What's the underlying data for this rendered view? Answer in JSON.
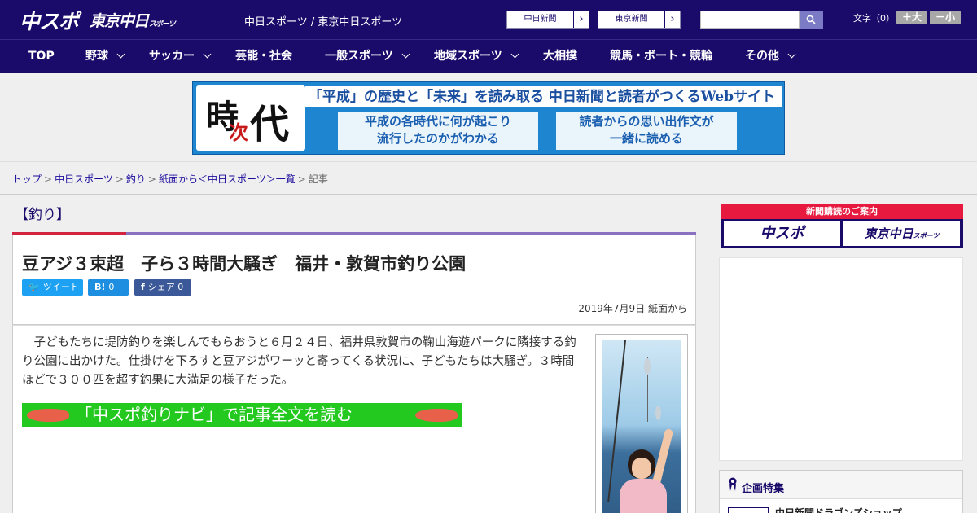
{
  "header": {
    "logo_chuspo": "中スポ",
    "logo_tokyo": "東京中日",
    "logo_tokyo_small": "スポーツ",
    "site_names": "中日スポーツ / 東京中日スポーツ",
    "paper_links": [
      "中日新聞",
      "東京新聞"
    ],
    "search_placeholder": "",
    "font_size_label": "文字（0）",
    "font_plus": "＋大",
    "font_minus": "－小"
  },
  "nav": {
    "items": [
      {
        "label": "TOP"
      },
      {
        "label": "野球"
      },
      {
        "label": "サッカー"
      },
      {
        "label": "芸能・社会"
      },
      {
        "label": "一般スポーツ"
      },
      {
        "label": "地域スポーツ"
      },
      {
        "label": "大相撲"
      },
      {
        "label": "競馬・ボート・競輪"
      },
      {
        "label": "その他"
      }
    ]
  },
  "banner": {
    "logo_char_1": "時",
    "logo_char_2": "次",
    "logo_char_3": "代",
    "title": "「平成」の歴史と「未来」を読み取る 中日新聞と読者がつくるWebサイト",
    "box1_line1": "平成の各時代に何が起こり",
    "box1_line2": "流行したのかがわかる",
    "box2_line1": "読者からの思い出作文が",
    "box2_line2": "一緒に読める"
  },
  "breadcrumb": {
    "items": [
      "トップ",
      "中日スポーツ",
      "釣り",
      "紙面から＜中日スポーツ＞一覧"
    ],
    "current": "記事",
    "separator": ">"
  },
  "category": {
    "label": "【釣り】"
  },
  "article": {
    "title": "豆アジ３束超　子ら３時間大騒ぎ　福井・敦賀市釣り公園",
    "share_tweet": "ツイート",
    "share_hatena_icon": "B!",
    "share_hatena_count": "0",
    "share_fb_label": "シェア",
    "share_fb_count": "0",
    "date": "2019年7月9日 紙面から",
    "body": "子どもたちに堤防釣りを楽しんでもらおうと６月２４日、福井県敦賀市の鞠山海遊パークに隣接する釣り公園に出かけた。仕掛けを下ろすと豆アジがワーッと寄ってくる状況に、子どもたちは大騒ぎ。３時間ほどで３００匹を超す釣果に大満足の様子だった。",
    "cta": "「中スポ釣りナビ」で記事全文を読む"
  },
  "sidebar": {
    "sub_ad_title": "新聞購読のご案内",
    "sub_ad_btn_1": "中スポ",
    "sub_ad_btn_2": "東京中日",
    "sub_ad_btn_2_small": "スポーツ",
    "special_title": "企画特集",
    "special_item": "中日新聞ドラゴンズショップ"
  },
  "colors": {
    "brand_navy": "#1a0b6b",
    "accent_red": "#d2243f",
    "cta_green": "#24c920"
  }
}
